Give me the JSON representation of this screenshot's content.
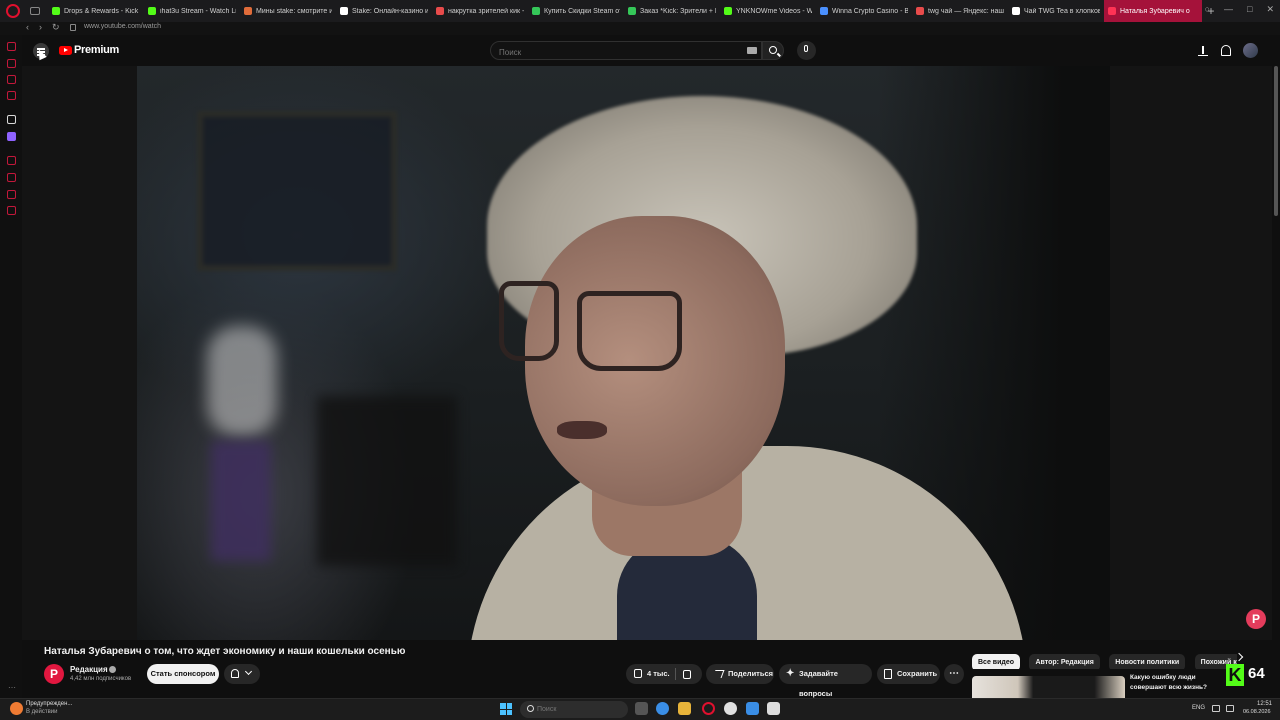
{
  "browser": {
    "tabs": [
      {
        "label": "Drops & Rewards - Kick Da",
        "fav": "#53fc18"
      },
      {
        "label": "ihat3u Stream - Watch Live",
        "fav": "#53fc18"
      },
      {
        "label": "Мины stake: смотрите и с",
        "fav": "#e06c3a"
      },
      {
        "label": "Stake: Онлайн-казино и с",
        "fav": "#ffffff"
      },
      {
        "label": "накрутка зрителей кик -",
        "fav": "#e84b4b"
      },
      {
        "label": "Купить Скидки Steam от",
        "fav": "#35c759"
      },
      {
        "label": "Заказ *Kick: Зрители + Ин",
        "fav": "#35c759"
      },
      {
        "label": "YNKNOWme Videos - Watc",
        "fav": "#53fc18"
      },
      {
        "label": "Winna Crypto Casino - Bes",
        "fav": "#4a90ff"
      },
      {
        "label": "twg чай — Яндекс: нашло",
        "fav": "#e84b4b"
      },
      {
        "label": "Чай TWG Tea в хлопковы",
        "fav": "#ffffff"
      },
      {
        "label": "Наталья Зубаревич о",
        "fav": "#ff3355",
        "active": true
      }
    ],
    "url": "www.youtube.com/watch",
    "new_tab": "+"
  },
  "masthead": {
    "logo_text": "Premium",
    "search_placeholder": "Поиск"
  },
  "video": {
    "title": "Наталья Зубаревич о том, что ждет экономику и наши кошельки осенью",
    "watermark": "Р"
  },
  "channel": {
    "avatar_letter": "Р",
    "name": "Редакция",
    "subscribers": "4,42 млн подписчиков",
    "sponsor_label": "Стать спонсором"
  },
  "actions": {
    "likes": "4 тыс.",
    "share": "Поделиться",
    "ask": "Задавайте вопросы",
    "save": "Сохранить",
    "more": "⋯"
  },
  "chips": [
    "Все видео",
    "Автор: Редакция",
    "Новости политики",
    "Похожий контент"
  ],
  "recommendation": {
    "title": "Какую ошибку люди совершают всю жизнь? Нейробиолог ..."
  },
  "kick_overlay": {
    "letter": "K",
    "count": "64"
  },
  "taskbar": {
    "notification_title": "Предупрежден...",
    "notification_sub": "В действии",
    "search_placeholder": "Поиск",
    "lang": "ENG",
    "time": "12:51",
    "date": "06.08.2026"
  }
}
